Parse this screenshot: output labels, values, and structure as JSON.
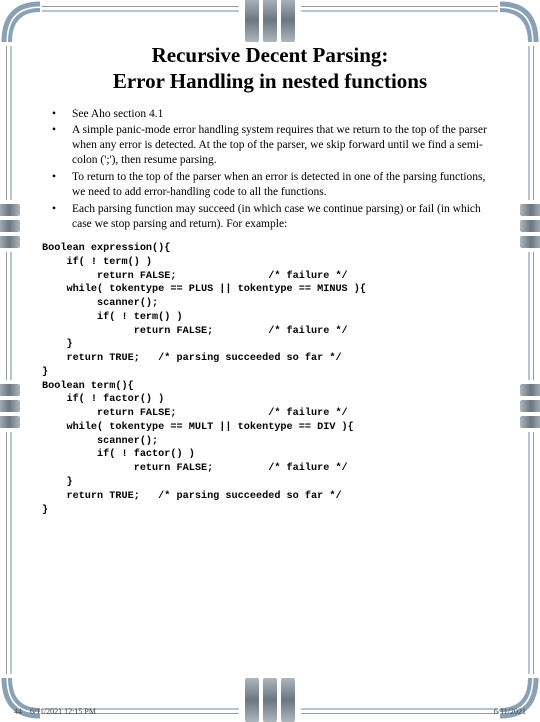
{
  "title_line1": "Recursive Decent Parsing:",
  "title_line2": "Error Handling in nested functions",
  "bullets": [
    "See Aho section 4.1",
    "A simple panic-mode error handling system requires that we return to the top of the parser when any error is detected.  At the top of the parser, we skip forward until we find a semi-colon (';'), then resume parsing.",
    "To return to the top of the parser when an error is detected in one of the parsing functions, we need to add error-handling code to all the functions.",
    "Each parsing function may succeed (in which case we continue parsing) or fail (in which case we stop parsing and return).  For example:"
  ],
  "code": "Boolean expression(){\n    if( ! term() )\n         return FALSE;               /* failure */\n    while( tokentype == PLUS || tokentype == MINUS ){\n         scanner();\n         if( ! term() )\n               return FALSE;         /* failure */\n    }\n    return TRUE;   /* parsing succeeded so far */\n}\nBoolean term(){\n    if( ! factor() )\n         return FALSE;               /* failure */\n    while( tokentype == MULT || tokentype == DIV ){\n         scanner();\n         if( ! factor() )\n               return FALSE;         /* failure */\n    }\n    return TRUE;   /* parsing succeeded so far */\n}",
  "footer": {
    "page": "44",
    "left_date": "6/11/2021 12:15 PM",
    "right_date": "6/11/2021"
  }
}
